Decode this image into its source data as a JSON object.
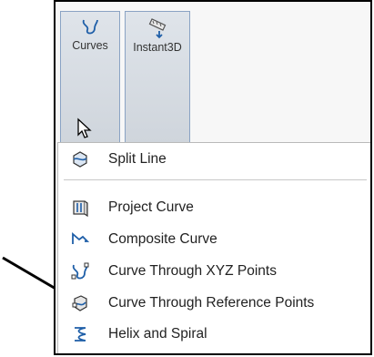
{
  "ribbon": {
    "buttons": [
      {
        "label": "Curves",
        "icon": "curves-icon"
      },
      {
        "label": "Instant3D",
        "icon": "instant3d-icon"
      }
    ]
  },
  "menu": {
    "items": [
      {
        "label": "Split Line",
        "icon": "split-line-icon"
      },
      {
        "label": "Project Curve",
        "icon": "project-curve-icon"
      },
      {
        "label": "Composite Curve",
        "icon": "composite-curve-icon"
      },
      {
        "label": "Curve Through XYZ Points",
        "icon": "curve-xyz-points-icon"
      },
      {
        "label": "Curve Through Reference Points",
        "icon": "curve-reference-points-icon"
      },
      {
        "label": "Helix and Spiral",
        "icon": "helix-spiral-icon"
      }
    ]
  },
  "colors": {
    "accent_blue": "#1f5fa8",
    "ribbon_button_fill": "#d6dbe1",
    "ribbon_button_border": "#8aa3c4"
  }
}
